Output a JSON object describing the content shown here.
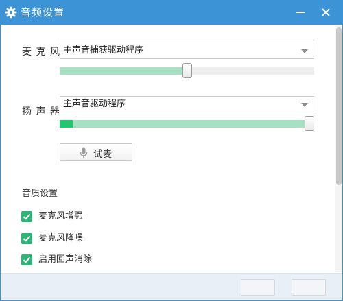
{
  "window": {
    "title": "音频设置",
    "title_icon": "gear-icon",
    "controls": {
      "minimize_icon": "minimize-icon",
      "close_icon": "close-icon"
    }
  },
  "microphone": {
    "label": "麦 克 风",
    "device": "主声音捕获驱动程序",
    "volume_fraction": 0.5
  },
  "speaker": {
    "label": "扬 声 器",
    "device": "主声音驱动程序",
    "volume_fraction": 1.0,
    "level_fraction": 0.05
  },
  "test_button": {
    "label": "试麦",
    "icon": "microphone-icon"
  },
  "quality": {
    "title": "音质设置",
    "options": [
      {
        "label": "麦克风增强",
        "checked": true
      },
      {
        "label": "麦克风降噪",
        "checked": true
      },
      {
        "label": "启用回声消除",
        "checked": true
      }
    ]
  },
  "footer": {
    "buttons": [
      "",
      ""
    ]
  },
  "colors": {
    "titlebar": "#3c94d6",
    "slider_fill": "#a8e0c3",
    "level": "#25c46e",
    "checkbox": "#2fb47a"
  }
}
